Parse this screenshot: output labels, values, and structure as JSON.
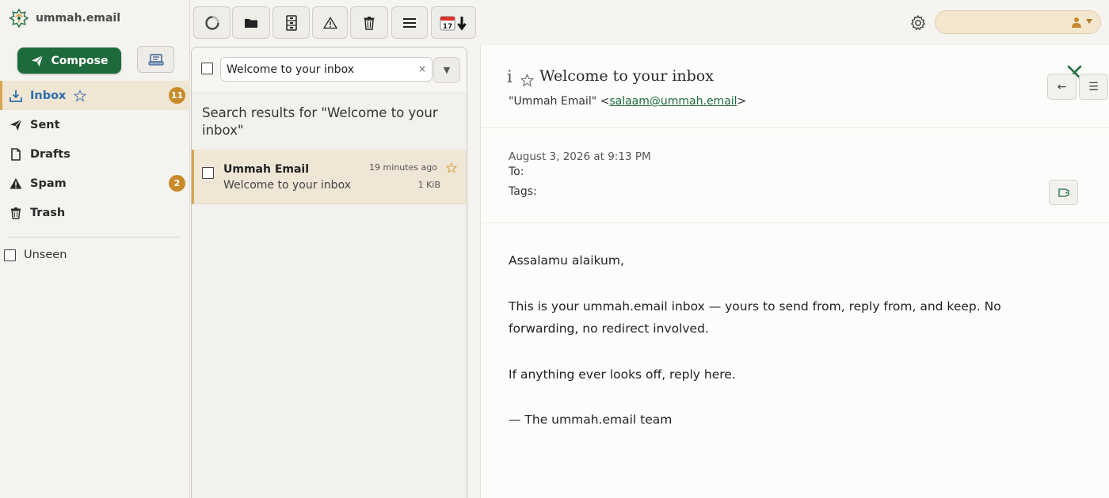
{
  "app": {
    "brand_name": "ummah.email",
    "colors": {
      "accent": "#1d6b3c",
      "highlight": "#d9a44e",
      "badge": "#c88a2a",
      "active_link": "#2f6dab"
    }
  },
  "sidebar": {
    "compose_label": "Compose",
    "folders": [
      {
        "label": "Inbox",
        "icon": "inbox-icon",
        "badge": "11",
        "active": true
      },
      {
        "label": "Sent",
        "icon": "send-icon"
      },
      {
        "label": "Drafts",
        "icon": "draft-icon"
      },
      {
        "label": "Spam",
        "icon": "spam-icon",
        "badge": "2"
      },
      {
        "label": "Trash",
        "icon": "trash-icon"
      }
    ],
    "unseen_label": "Unseen"
  },
  "toolbar": {
    "buttons": [
      "refresh-icon",
      "folder-icon",
      "archive-icon",
      "spam-icon",
      "trash-icon",
      "menu-icon",
      "calendar-import-icon"
    ]
  },
  "list": {
    "search_value": "Welcome to your inbox",
    "search_clear": "×",
    "search_dropdown": "▼",
    "results_title": "Search results for \"Welcome to your inbox\"",
    "messages": [
      {
        "from": "Ummah Email",
        "subject": "Welcome to your inbox",
        "time": "19 minutes ago",
        "size": "1 KiB"
      }
    ]
  },
  "reader": {
    "info_glyph": "i",
    "subject": "Welcome to your inbox",
    "from_name": "\"Ummah Email\" <",
    "from_email": "salaam@ummah.email",
    "from_close": ">",
    "back_glyph": "←",
    "menu_glyph": "☰",
    "date": "August 3, 2026 at 9:13 PM",
    "to_label": "To:",
    "tags_label": "Tags:",
    "body": [
      "Assalamu alaikum,",
      "This is your ummah.email inbox — yours to send from, reply from, and keep. No forwarding, no redirect involved.",
      "If anything ever looks off, reply here.",
      "— The ummah.email team"
    ]
  }
}
